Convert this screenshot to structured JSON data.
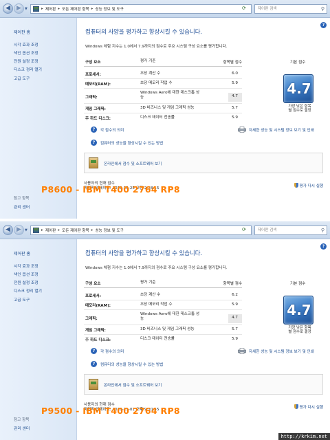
{
  "panels": [
    {
      "breadcrumb": [
        "제어판",
        "모든 제어판 항목",
        "성능 정보 및 도구"
      ],
      "search_placeholder": "제어판 검색",
      "sidebar": {
        "home": "제어판 홈",
        "tasks": [
          "시각 효과 조정",
          "색인 옵션 조정",
          "전원 설정 조정",
          "디스크 정리 열기",
          "고급 도구"
        ],
        "see_also": "참고 항목",
        "action": "관리 센터"
      },
      "heading": "컴퓨터의 사양을 평가하고 향상시킬 수 있습니다.",
      "intro": "Windows 체험 지수는 1.0에서 7.9까지의 점수로 주요 시스템 구성 요소를 평가합니다.",
      "table": {
        "headers": [
          "구성 요소",
          "평가 기준",
          "항목별 점수",
          "기본 점수"
        ],
        "rows": [
          {
            "component": "프로세서:",
            "criteria": "초당 계산 수",
            "score": "6.0"
          },
          {
            "component": "메모리(RAM):",
            "criteria": "초당 메모리 작업 수",
            "score": "5.9"
          },
          {
            "component": "그래픽:",
            "criteria": "Windows Aero에 대한 데스크톱 성능",
            "score": "4.7"
          },
          {
            "component": "게임 그래픽:",
            "criteria": "3D 비즈니스 및 게임 그래픽 성능",
            "score": "5.7"
          },
          {
            "component": "주 하드 디스크:",
            "criteria": "디스크 데이터 전송률",
            "score": "5.9"
          }
        ]
      },
      "base_score": "4.7",
      "base_caption": "가장 낮은 항목\n별 점수로 결정",
      "links": {
        "meaning": "각 점수의 의미",
        "tips": "컴퓨터의 성능을 향상시킬 수 있는 방법",
        "details": "자세한 성능 및 시스템 정보 보기 및 인쇄",
        "online": "온라인에서 점수 및 소프트웨어 보기"
      },
      "current_label": "사용자의 현재 점수",
      "last_update": "마지막 업데이트: 2010-10-25 오전 2:18:15",
      "rerun": "평가 다시 실행",
      "caption": "P8600 - IBM T400 2764 RP8"
    },
    {
      "breadcrumb": [
        "제어판",
        "모든 제어판 항목",
        "성능 정보 및 도구"
      ],
      "search_placeholder": "제어판 검색",
      "sidebar": {
        "home": "제어판 홈",
        "tasks": [
          "시각 효과 조정",
          "색인 옵션 조정",
          "전원 설정 조정",
          "디스크 정리 열기",
          "고급 도구"
        ],
        "see_also": "참고 항목",
        "action": "관리 센터"
      },
      "heading": "컴퓨터의 사양을 평가하고 향상시킬 수 있습니다.",
      "intro": "Windows 체험 지수는 1.0에서 7.9까지의 점수로 주요 시스템 구성 요소를 평가합니다.",
      "table": {
        "headers": [
          "구성 요소",
          "평가 기준",
          "항목별 점수",
          "기본 점수"
        ],
        "rows": [
          {
            "component": "프로세서:",
            "criteria": "초당 계산 수",
            "score": "6.2"
          },
          {
            "component": "메모리(RAM):",
            "criteria": "초당 메모리 작업 수",
            "score": "5.9"
          },
          {
            "component": "그래픽:",
            "criteria": "Windows Aero에 대한 데스크톱 성능",
            "score": "4.7"
          },
          {
            "component": "게임 그래픽:",
            "criteria": "3D 비즈니스 및 게임 그래픽 성능",
            "score": "5.7"
          },
          {
            "component": "주 하드 디스크:",
            "criteria": "디스크 데이터 전송률",
            "score": "5.9"
          }
        ]
      },
      "base_score": "4.7",
      "base_caption": "가장 낮은 항목\n별 점수로 결정",
      "links": {
        "meaning": "각 점수의 의미",
        "tips": "컴퓨터의 성능을 향상시킬 수 있는 방법",
        "details": "자세한 성능 및 시스템 정보 보기 및 인쇄",
        "online": "온라인에서 점수 및 소프트웨어 보기"
      },
      "current_label": "사용자의 현재 점수",
      "last_update": "마지막 업데이트: 2010-11-01 오후 9:10:55",
      "rerun": "평가 다시 실행",
      "caption": "P9500 - IBM T400 2764 RP8"
    }
  ],
  "watermark": "http://krkim.net"
}
